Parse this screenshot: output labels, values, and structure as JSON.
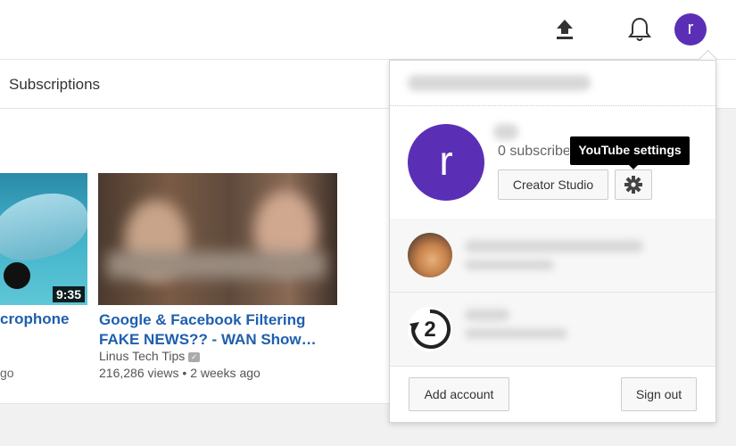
{
  "header": {
    "upload_icon": "upload-icon",
    "bell_icon": "bell-icon",
    "avatar_letter": "r",
    "avatar_color": "#5b2fb5"
  },
  "subbar": {
    "label": "Subscriptions"
  },
  "videos": [
    {
      "title": "crophone",
      "duration": "9:35",
      "ago": "go"
    },
    {
      "title": "Google & Facebook Filtering FAKE NEWS?? - WAN Show…",
      "channel": "Linus Tech Tips",
      "views": "216,286 views",
      "separator": "•",
      "ago": "2 weeks ago"
    }
  ],
  "menu": {
    "avatar_letter": "r",
    "subscribers_text": "0 subscribers",
    "creator_studio_label": "Creator Studio",
    "settings_tooltip": "YouTube settings",
    "add_account_label": "Add account",
    "sign_out_label": "Sign out",
    "brand_account_glyph": "2"
  },
  "colors": {
    "link": "#1e5fae",
    "accent": "#5b2fb5"
  }
}
